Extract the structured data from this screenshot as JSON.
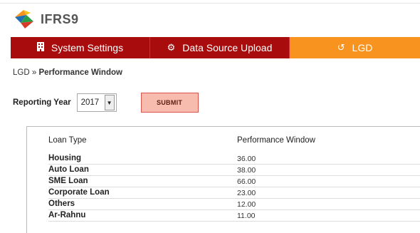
{
  "app": {
    "name": "IFRS9"
  },
  "nav": {
    "tabs": [
      {
        "label": "System Settings",
        "icon": "building-icon"
      },
      {
        "label": "Data Source Upload",
        "icon": "gears-icon"
      },
      {
        "label": "LGD",
        "icon": "history-icon",
        "active": true
      }
    ]
  },
  "breadcrumb": {
    "root": "LGD",
    "separator": "»",
    "current": "Performance Window"
  },
  "form": {
    "reporting_year_label": "Reporting Year",
    "reporting_year_value": "2017",
    "submit_label": "SUBMIT"
  },
  "table": {
    "columns": [
      "Loan Type",
      "Performance Window"
    ],
    "rows": [
      {
        "loan_type": "Housing",
        "window": "36.00"
      },
      {
        "loan_type": "Auto Loan",
        "window": "38.00"
      },
      {
        "loan_type": "SME Loan",
        "window": "66.00"
      },
      {
        "loan_type": "Corporate Loan",
        "window": "23.00"
      },
      {
        "loan_type": "Others",
        "window": "12.00"
      },
      {
        "loan_type": "Ar-Rahnu",
        "window": "11.00"
      }
    ]
  },
  "colors": {
    "nav_dark": "#a80c0c",
    "nav_active": "#f8931f",
    "submit_bg": "#f8bcae"
  }
}
